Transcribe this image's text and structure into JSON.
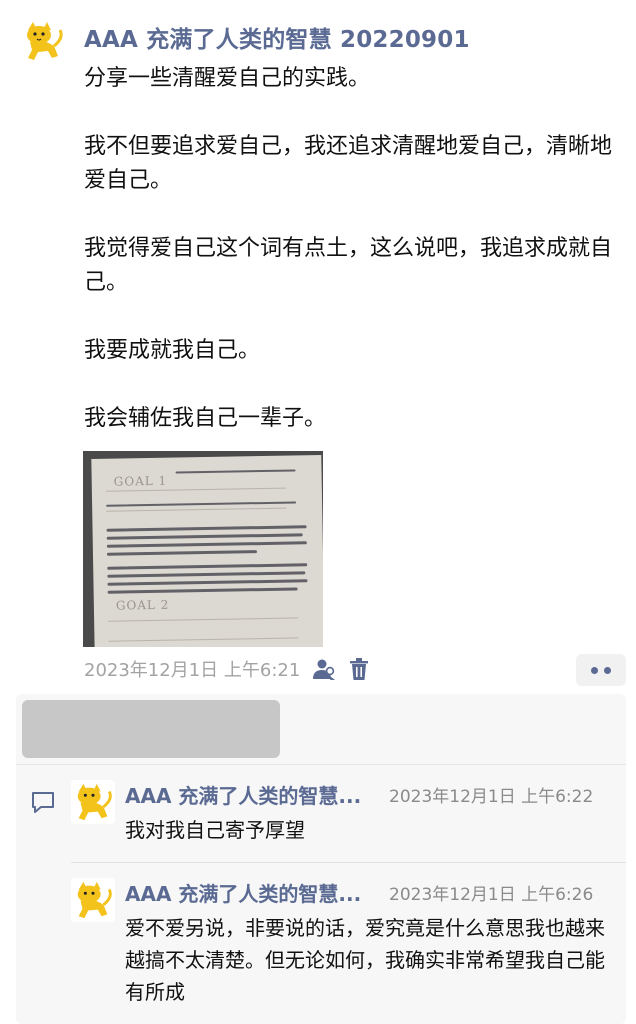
{
  "post": {
    "author": "AAA 充满了人类的智慧 20220901",
    "paragraphs": [
      "分享一些清醒爱自己的实践。",
      "我不但要追求爱自己，我还追求清醒地爱自己，清晰地爱自己。",
      "我觉得爱自己这个词有点土，这么说吧，我追求成就自己。",
      "我要成就我自己。",
      "我会辅佐我自己一辈子。"
    ],
    "photo": {
      "goal1": "GOAL 1",
      "goal2": "GOAL 2"
    },
    "time": "2023年12月1日 上午6:21"
  },
  "comments": [
    {
      "author": "AAA 充满了人类的智慧...",
      "time": "2023年12月1日 上午6:22",
      "text": "我对我自己寄予厚望"
    },
    {
      "author": "AAA 充满了人类的智慧...",
      "time": "2023年12月1日 上午6:26",
      "text": "爱不爱另说，非要说的话，爱究竟是什么意思我也越来越搞不太清楚。但无论如何，我确实非常希望我自己能有所成"
    }
  ],
  "icons": {
    "private": "private-people-icon",
    "delete": "trash-icon",
    "more": "more-dots-icon",
    "comment": "comment-bubble-icon",
    "avatar": "yellow-cat-avatar"
  },
  "colors": {
    "name": "#5a6a93",
    "timestamp": "#a3a3a3",
    "comment_bg": "#f7f7f7"
  }
}
